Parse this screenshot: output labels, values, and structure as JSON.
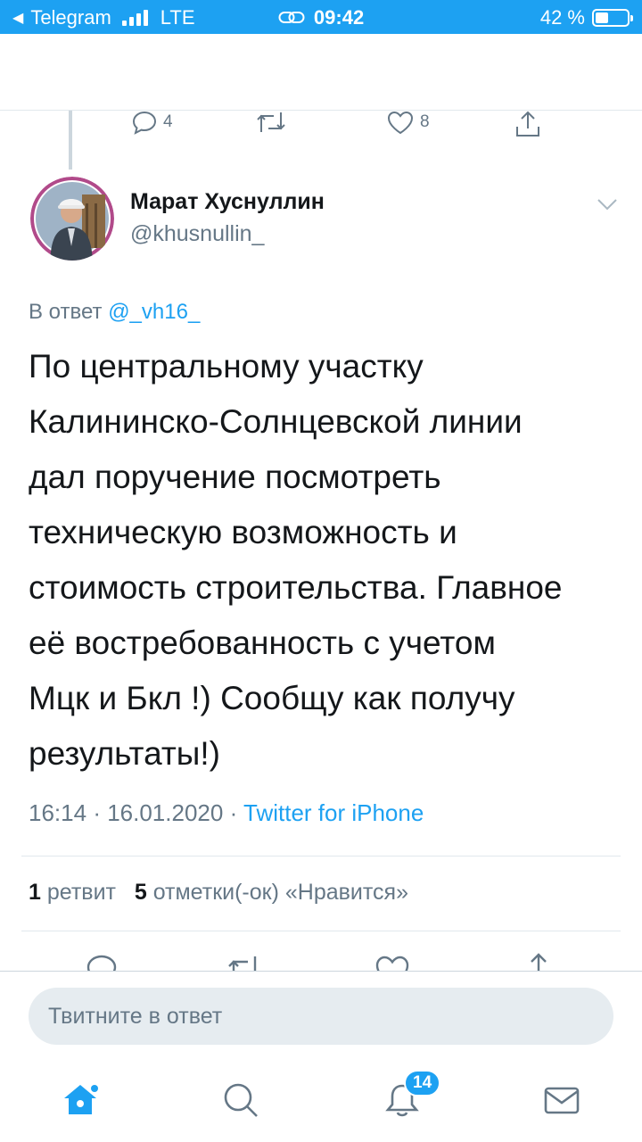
{
  "status_bar": {
    "back_app": "Telegram",
    "network": "LTE",
    "time": "09:42",
    "battery": "42 %",
    "battery_level": 0.42
  },
  "parent_actions": {
    "reply_count": "4",
    "like_count": "8"
  },
  "tweet": {
    "author_name": "Марат Хуснуллин",
    "author_handle": "@khusnullin_",
    "reply_prefix": "В ответ",
    "reply_to": "@_vh16_",
    "lines": [
      "По центральному участку",
      "Калининско-Солнцевской линии",
      "дал поручение посмотреть",
      "техническую возможность и",
      "стоимость строительства. Главное",
      "её востребованность с учетом",
      "Мцк и Бкл !) Сообщу как получу",
      "результаты!)"
    ],
    "time": "16:14",
    "date": "16.01.2020",
    "source": "Twitter for iPhone",
    "retweets_count": "1",
    "retweets_label": "ретвит",
    "likes_count": "5",
    "likes_label": "отметки(-ок) «Нравится»"
  },
  "reply_bar": {
    "placeholder": "Твитните в ответ"
  },
  "tabbar": {
    "notifications_badge": "14"
  },
  "colors": {
    "accent": "#1da1f2",
    "secondary_text": "#657786",
    "divider": "#e1e8ed"
  }
}
